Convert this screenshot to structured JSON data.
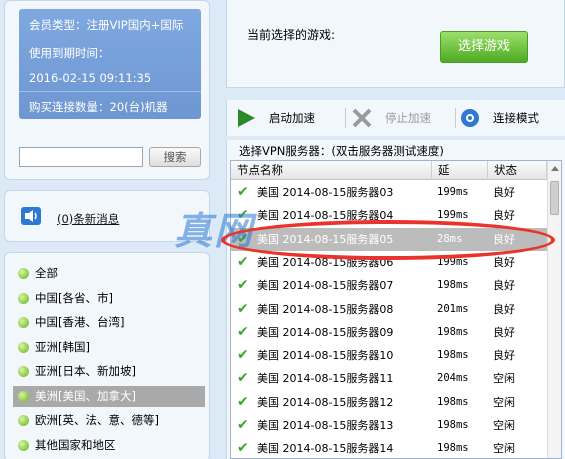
{
  "account": {
    "member_type": "会员类型：注册VIP国内+国际",
    "expire_label": "使用到期时间：",
    "expire_time": "2016-02-15 09:11:35",
    "connections": "购买连接数量：20(台)机器"
  },
  "search": {
    "placeholder": "",
    "button_label": "搜索"
  },
  "messages": {
    "label": "(0)条新消息"
  },
  "regions": [
    {
      "label": "全部"
    },
    {
      "label": "中国[各省、市]"
    },
    {
      "label": "中国[香港、台湾]"
    },
    {
      "label": "亚洲[韩国]"
    },
    {
      "label": "亚洲[日本、新加坡]"
    },
    {
      "label": "美洲[美国、加拿大]"
    },
    {
      "label": "欧洲[英、法、意、德等]"
    },
    {
      "label": "其他国家和地区"
    }
  ],
  "selected_region_index": 5,
  "game": {
    "current_label": "当前选择的游戏:",
    "select_button": "选择游戏"
  },
  "toolbar": {
    "start_label": "启动加速",
    "stop_label": "停止加速",
    "mode_label": "连接模式"
  },
  "server_list": {
    "title": "选择VPN服务器：(双击服务器测试速度)",
    "headers": {
      "name": "节点名称",
      "ping": "延",
      "status": "状态"
    },
    "rows": [
      {
        "name": "美国 2014-08-15服务器03",
        "ping": "199ms",
        "status": "良好"
      },
      {
        "name": "美国 2014-08-15服务器04",
        "ping": "199ms",
        "status": "良好"
      },
      {
        "name": "美国 2014-08-15服务器05",
        "ping": "28ms",
        "status": "良好"
      },
      {
        "name": "美国 2014-08-15服务器06",
        "ping": "199ms",
        "status": "良好"
      },
      {
        "name": "美国 2014-08-15服务器07",
        "ping": "198ms",
        "status": "良好"
      },
      {
        "name": "美国 2014-08-15服务器08",
        "ping": "201ms",
        "status": "良好"
      },
      {
        "name": "美国 2014-08-15服务器09",
        "ping": "198ms",
        "status": "良好"
      },
      {
        "name": "美国 2014-08-15服务器10",
        "ping": "198ms",
        "status": "良好"
      },
      {
        "name": "美国 2014-08-15服务器11",
        "ping": "204ms",
        "status": "空闲"
      },
      {
        "name": "美国 2014-08-15服务器12",
        "ping": "198ms",
        "status": "空闲"
      },
      {
        "name": "美国 2014-08-15服务器13",
        "ping": "198ms",
        "status": "空闲"
      },
      {
        "name": "美国 2014-08-15服务器14",
        "ping": "198ms",
        "status": "空闲"
      }
    ],
    "selected_row_index": 2
  },
  "watermark_text": "真网"
}
